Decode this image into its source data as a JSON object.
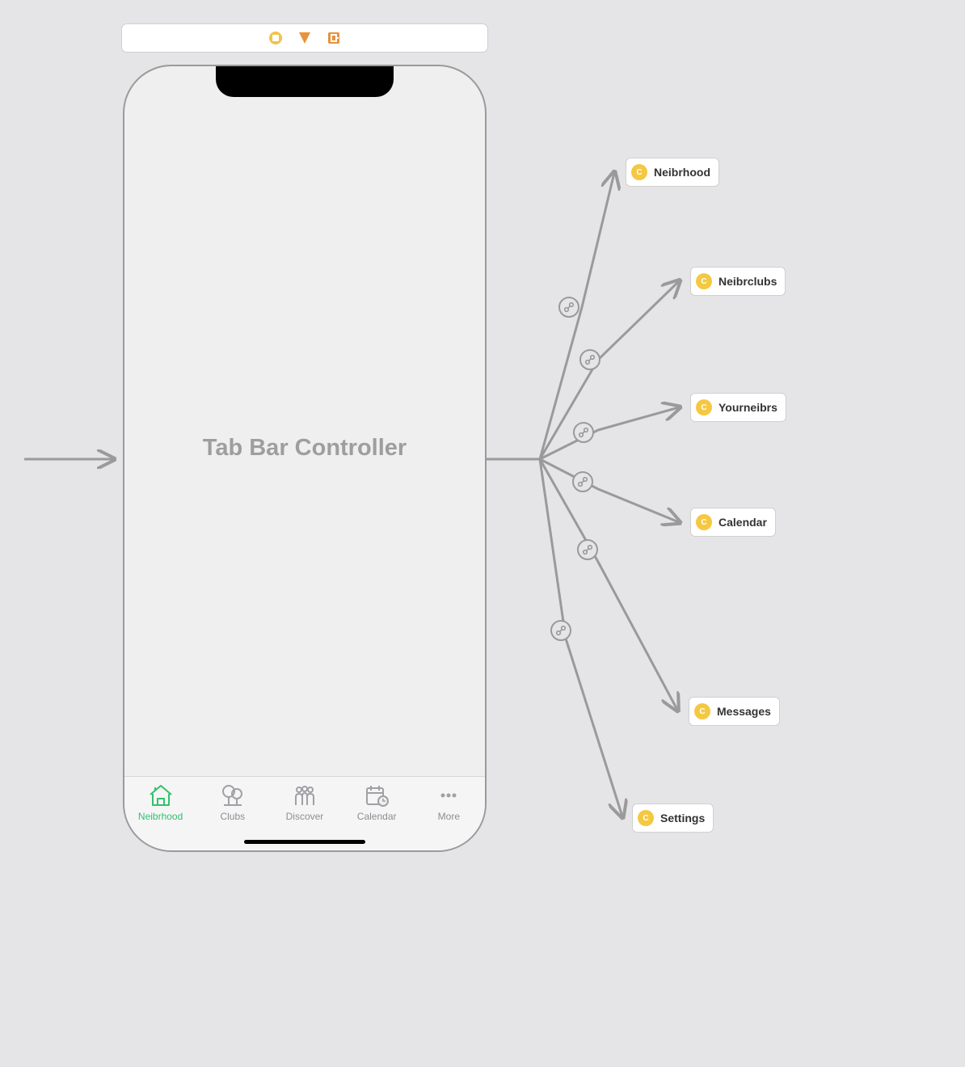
{
  "phone_title": "Tab Bar Controller",
  "tabs": [
    {
      "label": "Neibrhood",
      "active": true
    },
    {
      "label": "Clubs",
      "active": false
    },
    {
      "label": "Discover",
      "active": false
    },
    {
      "label": "Calendar",
      "active": false
    },
    {
      "label": "More",
      "active": false
    }
  ],
  "destinations": [
    {
      "label": "Neibrhood"
    },
    {
      "label": "Neibrclubs"
    },
    {
      "label": "Yourneibrs"
    },
    {
      "label": "Calendar"
    },
    {
      "label": "Messages"
    },
    {
      "label": "Settings"
    }
  ]
}
